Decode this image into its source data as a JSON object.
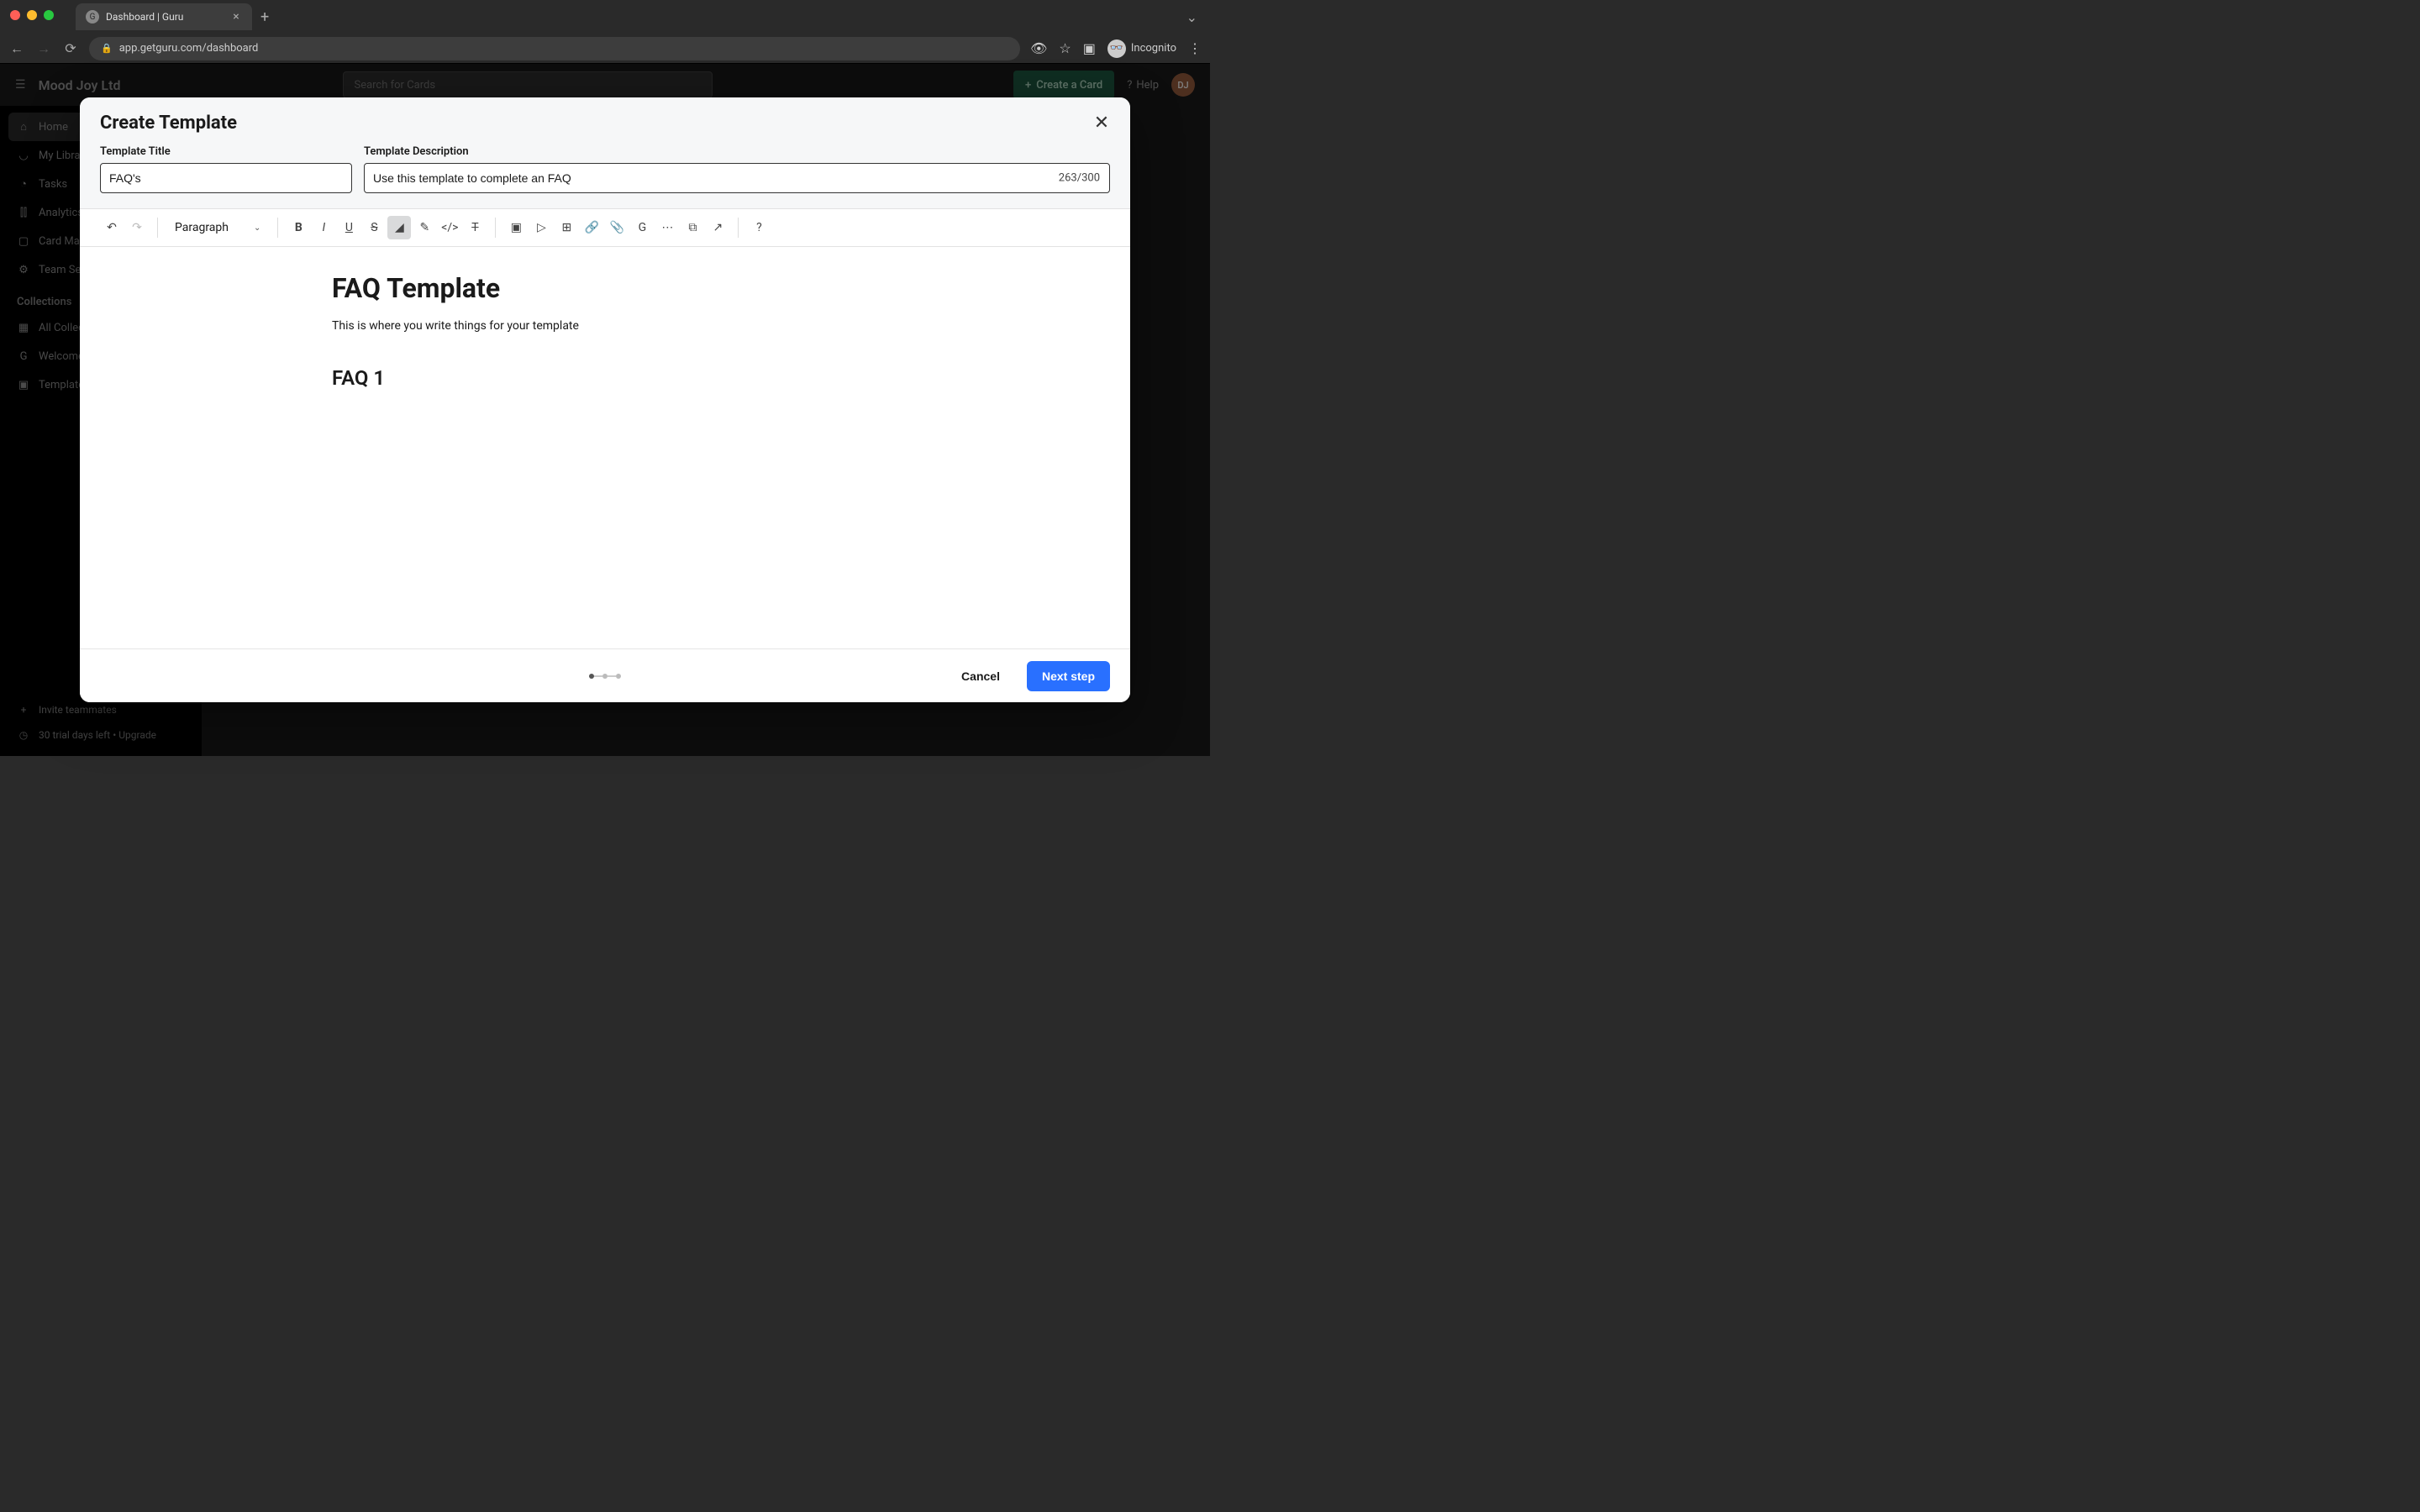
{
  "browser": {
    "tab_title": "Dashboard | Guru",
    "url": "app.getguru.com/dashboard",
    "incognito_label": "Incognito"
  },
  "app": {
    "company": "Mood Joy Ltd",
    "search_placeholder": "Search for Cards",
    "create_card_label": "Create a Card",
    "help_label": "Help",
    "avatar_initials": "DJ"
  },
  "sidebar": {
    "items": [
      {
        "icon": "⌂",
        "label": "Home"
      },
      {
        "icon": "◡",
        "label": "My Library"
      },
      {
        "icon": "◔",
        "label": "Tasks"
      },
      {
        "icon": "⫿⫿",
        "label": "Analytics"
      },
      {
        "icon": "▢",
        "label": "Card Manager"
      },
      {
        "icon": "⚙",
        "label": "Team Settings"
      }
    ],
    "collections_label": "Collections",
    "collections": [
      {
        "icon": "▦",
        "label": "All Collections"
      },
      {
        "icon": "G",
        "label": "Welcome to Guru!"
      },
      {
        "icon": "▣",
        "label": "Templates"
      }
    ],
    "footer": {
      "invite": "Invite teammates",
      "trial": "30 trial days left • Upgrade"
    }
  },
  "modal": {
    "title": "Create Template",
    "title_label": "Template Title",
    "title_value": "FAQ's",
    "desc_label": "Template Description",
    "desc_value": "Use this template to complete an FAQ",
    "char_count": "263/300",
    "style_dropdown": "Paragraph",
    "editor": {
      "heading": "FAQ Template",
      "paragraph": "This is where you write things for your template",
      "subheading": "FAQ 1"
    },
    "cancel": "Cancel",
    "next": "Next step"
  }
}
